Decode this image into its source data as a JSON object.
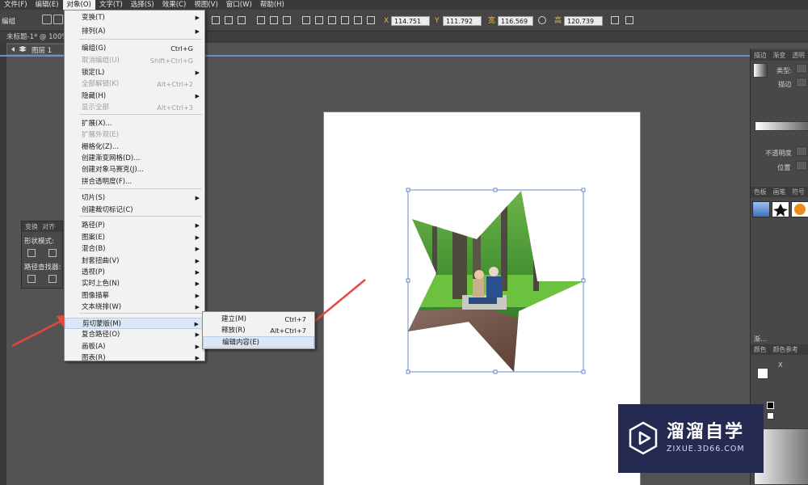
{
  "menubar": {
    "items": [
      "文件(F)",
      "编辑(E)",
      "对象(O)",
      "文字(T)",
      "选择(S)",
      "效果(C)",
      "视图(V)",
      "窗口(W)",
      "帮助(H)"
    ]
  },
  "toolbar": {
    "left_label": "编组",
    "fields": [
      {
        "label": "X",
        "value": "114.751"
      },
      {
        "label": "Y",
        "value": "111.792"
      },
      {
        "label": "宽",
        "value": "116.569"
      },
      {
        "label": "高",
        "value": "120.739"
      }
    ]
  },
  "document": {
    "tab_title": "未标题-1* @ 100%",
    "layer_name": "图层 1"
  },
  "object_menu": {
    "items": [
      {
        "label": "变换(T)",
        "shortcut": "",
        "submenu": true,
        "disabled": false
      },
      {
        "label": "排列(A)",
        "shortcut": "",
        "submenu": true,
        "disabled": false
      },
      {
        "label": "编组(G)",
        "shortcut": "Ctrl+G",
        "submenu": false,
        "disabled": false
      },
      {
        "label": "取消编组(U)",
        "shortcut": "Shift+Ctrl+G",
        "submenu": false,
        "disabled": true
      },
      {
        "label": "锁定(L)",
        "shortcut": "",
        "submenu": true,
        "disabled": false
      },
      {
        "label": "全部解锁(K)",
        "shortcut": "Alt+Ctrl+2",
        "submenu": false,
        "disabled": true
      },
      {
        "label": "隐藏(H)",
        "shortcut": "",
        "submenu": true,
        "disabled": false
      },
      {
        "label": "显示全部",
        "shortcut": "Alt+Ctrl+3",
        "submenu": false,
        "disabled": true
      },
      {
        "label": "扩展(X)...",
        "shortcut": "",
        "submenu": false,
        "disabled": false
      },
      {
        "label": "扩展外观(E)",
        "shortcut": "",
        "submenu": false,
        "disabled": true
      },
      {
        "label": "栅格化(Z)...",
        "shortcut": "",
        "submenu": false,
        "disabled": false
      },
      {
        "label": "创建渐变网格(D)...",
        "shortcut": "",
        "submenu": false,
        "disabled": false
      },
      {
        "label": "创建对象马赛克(J)...",
        "shortcut": "",
        "submenu": false,
        "disabled": false
      },
      {
        "label": "拼合透明度(F)...",
        "shortcut": "",
        "submenu": false,
        "disabled": false
      },
      {
        "label": "切片(S)",
        "shortcut": "",
        "submenu": true,
        "disabled": false
      },
      {
        "label": "创建裁切标记(C)",
        "shortcut": "",
        "submenu": false,
        "disabled": false
      },
      {
        "label": "路径(P)",
        "shortcut": "",
        "submenu": true,
        "disabled": false
      },
      {
        "label": "图案(E)",
        "shortcut": "",
        "submenu": true,
        "disabled": false
      },
      {
        "label": "混合(B)",
        "shortcut": "",
        "submenu": true,
        "disabled": false
      },
      {
        "label": "封套扭曲(V)",
        "shortcut": "",
        "submenu": true,
        "disabled": false
      },
      {
        "label": "透视(P)",
        "shortcut": "",
        "submenu": true,
        "disabled": false
      },
      {
        "label": "实时上色(N)",
        "shortcut": "",
        "submenu": true,
        "disabled": false
      },
      {
        "label": "图像描摹",
        "shortcut": "",
        "submenu": true,
        "disabled": false
      },
      {
        "label": "文本绕排(W)",
        "shortcut": "",
        "submenu": true,
        "disabled": false
      },
      {
        "label": "剪切蒙版(M)",
        "shortcut": "",
        "submenu": true,
        "disabled": false
      },
      {
        "label": "复合路径(O)",
        "shortcut": "",
        "submenu": true,
        "disabled": false
      },
      {
        "label": "画板(A)",
        "shortcut": "",
        "submenu": true,
        "disabled": false
      },
      {
        "label": "图表(R)",
        "shortcut": "",
        "submenu": true,
        "disabled": false
      }
    ]
  },
  "clip_submenu": {
    "items": [
      {
        "label": "建立(M)",
        "shortcut": "Ctrl+7"
      },
      {
        "label": "释放(R)",
        "shortcut": "Alt+Ctrl+7"
      },
      {
        "label": "编辑内容(E)",
        "shortcut": ""
      }
    ]
  },
  "pathfinder_panel": {
    "tabs": [
      "变换",
      "对齐"
    ],
    "shape_modes_label": "形状模式:",
    "pathfinder_label": "路径查找器:"
  },
  "right_panels": {
    "top_tabs": [
      "描边",
      "渐变",
      "透明"
    ],
    "type_label": "类型:",
    "stroke_label": "描边",
    "opacity_label": "不透明度",
    "position_label": "位置",
    "swatch_tabs": [
      "色板",
      "画笔",
      "符号"
    ],
    "color_tabs": [
      "颜色",
      "颜色参考"
    ],
    "x_mark": "X",
    "ellipsis_label": "渐..."
  },
  "watermark": {
    "title": "溜溜自学",
    "url": "ZIXUE.3D66.COM"
  },
  "colors": {
    "accent_blue": "#6e8fce",
    "highlight": "#dbe7f6",
    "arrow_red": "#e8463a",
    "watermark_bg": "#242a52"
  },
  "icons": [
    "star-clipping-mask",
    "annotation-arrow",
    "play-logo-icon",
    "submenu-arrow-icon"
  ]
}
